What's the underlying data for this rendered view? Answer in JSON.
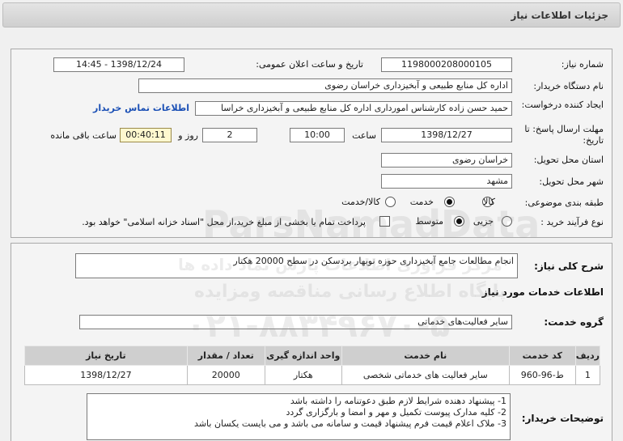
{
  "title": "جزئیات اطلاعات نیاز",
  "form": {
    "need_number_label": "شماره نیاز:",
    "need_number": "1198000208000105",
    "announce_label": "تاریخ و ساعت اعلان عمومی:",
    "announce_value": "1398/12/24 - 14:45",
    "buyer_label": "نام دستگاه خریدار:",
    "buyer_value": "اداره کل منابع طبیعی و آبخیزداری خراسان رضوی",
    "creator_label": "ایجاد کننده درخواست:",
    "creator_value": "حمید حسن زاده  کارشناس امورداری اداره کل منابع طبیعی و آبخیزداری خراسا",
    "contact_link": "اطلاعات تماس خریدار",
    "deadline_label": "مهلت ارسال پاسخ: تا تاریخ:",
    "deadline_date": "1398/12/27",
    "time_label": "ساعت",
    "deadline_time": "10:00",
    "days_value": "2",
    "days_label": "روز و",
    "remaining_time": "00:40:11",
    "remaining_label": "ساعت باقی مانده",
    "province_label": "استان محل تحویل:",
    "province_value": "خراسان رضوی",
    "city_label": "شهر محل تحویل:",
    "city_value": "مشهد",
    "category_label": "طبقه بندی موضوعی:",
    "category_options": [
      "کالا",
      "خدمت",
      "کالا/خدمت"
    ],
    "category_selected": 1,
    "process_label": "نوع فرآیند خرید :",
    "process_options": [
      "جزیی",
      "متوسط"
    ],
    "process_selected": 1,
    "payment_note": "پرداخت تمام یا بخشی از مبلغ خرید،از محل \"اسناد خزانه اسلامی\" خواهد بود."
  },
  "description": {
    "label": "شرح کلی نیاز:",
    "value": "انجام مطالعات جامع آبخیزداری حوزه نوبهار بردسکن در سطح 20000 هکتار"
  },
  "services": {
    "section_title": "اطلاعات خدمات مورد نیاز",
    "group_label": "گروه خدمت:",
    "group_value": "سایر فعالیت‌های خدماتی",
    "columns": [
      "ردیف",
      "کد خدمت",
      "نام خدمت",
      "واحد اندازه گیری",
      "تعداد / مقدار",
      "تاریخ نیاز"
    ],
    "rows": [
      [
        "1",
        "ط-96-960",
        "سایر فعالیت های خدماتی شخصی",
        "هکتار",
        "20000",
        "1398/12/27"
      ]
    ]
  },
  "notes": {
    "label": "توضیحات خریدار:",
    "lines": [
      "1- پیشنهاد دهنده شرایط لازم طبق دعوتنامه را داشته باشد",
      "2- کلیه مدارک پیوست تکمیل و مهر و امضا و بارگزاری گردد",
      "3- ملاک اعلام قیمت فرم پیشنهاد قیمت و سامانه می باشد و می بایست یکسان باشد"
    ]
  },
  "watermark": {
    "line1": "ParsNamadData",
    "line2": "مرکز فراوری اطلاعات پارس نماد داده ها",
    "line3": "پایگاه اطلاع رسانی مناقصه ومزایده",
    "line4": "۰۲۱-۸۸۳۴۹۶۷۰-۵"
  }
}
